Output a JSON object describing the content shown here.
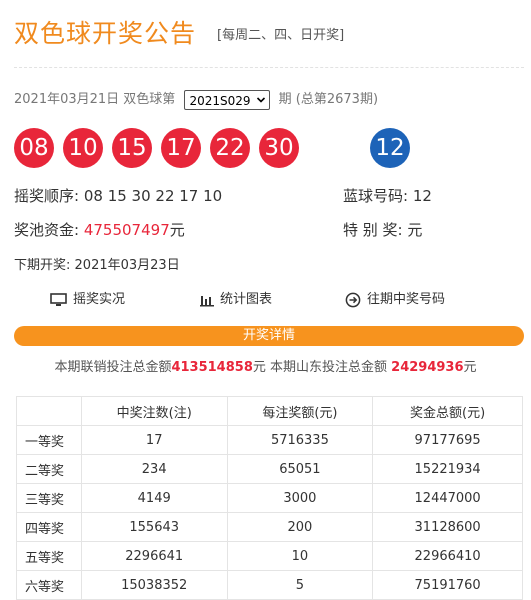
{
  "header": {
    "title": "双色球开奖公告",
    "subtitle": "[每周二、四、日开奖]"
  },
  "issue": {
    "date_label": "2021年03月21日 双色球第",
    "selected": "2021S029",
    "suffix": "期 (总第2673期)"
  },
  "balls": {
    "red": [
      "08",
      "10",
      "15",
      "17",
      "22",
      "30"
    ],
    "blue": "12",
    "colors": {
      "red": "#e8263a",
      "blue": "#1d63b8"
    }
  },
  "draw_info": {
    "order_label": "摇奖顺序:",
    "order_value": "08 15 30 22 17 10",
    "blue_label": "蓝球号码:",
    "blue_value": "12",
    "pool_label": "奖池资金:",
    "pool_value": "475507497",
    "pool_unit": "元",
    "special_label": "特 别 奖:",
    "special_value": "元",
    "next_label": "下期开奖:",
    "next_value": "2021年03月23日"
  },
  "links": [
    {
      "label": "摇奖实况",
      "icon": "monitor-icon"
    },
    {
      "label": "统计图表",
      "icon": "bar-chart-icon"
    },
    {
      "label": "往期中奖号码",
      "icon": "arrow-circle-icon"
    }
  ],
  "detail_bar": {
    "label": "开奖详情",
    "color": "#f7931e"
  },
  "sales": {
    "prefix": "本期联销投注总金额",
    "total": "413514858",
    "mid": "元 本期山东投注总金额",
    "local": "24294936",
    "suffix": "元"
  },
  "table": {
    "headers": [
      "",
      "中奖注数(注)",
      "每注奖额(元)",
      "奖金总额(元)"
    ],
    "rows": [
      [
        "一等奖",
        "17",
        "5716335",
        "97177695"
      ],
      [
        "二等奖",
        "234",
        "65051",
        "15221934"
      ],
      [
        "三等奖",
        "4149",
        "3000",
        "12447000"
      ],
      [
        "四等奖",
        "155643",
        "200",
        "31128600"
      ],
      [
        "五等奖",
        "2296641",
        "10",
        "22966410"
      ],
      [
        "六等奖",
        "15038352",
        "5",
        "75191760"
      ]
    ]
  }
}
